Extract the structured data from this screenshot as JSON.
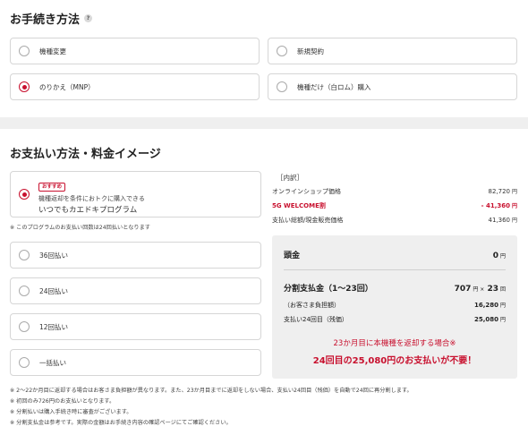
{
  "procedure": {
    "title": "お手続き方法",
    "help_icon": "?",
    "options": [
      {
        "label": "機種変更",
        "selected": false
      },
      {
        "label": "新規契約",
        "selected": false
      },
      {
        "label": "のりかえ（MNP）",
        "selected": true
      },
      {
        "label": "機種だけ（白ロム）購入",
        "selected": false
      }
    ]
  },
  "payment": {
    "title": "お支払い方法・料金イメージ",
    "recommended": {
      "badge": "おすすめ",
      "subtitle": "機種返却を条件におトクに購入できる",
      "title": "いつでもカエドキプログラム",
      "selected": true
    },
    "program_note": "※ このプログラムのお支払い回数は24回払いとなります",
    "options": [
      {
        "label": "36回払い"
      },
      {
        "label": "24回払い"
      },
      {
        "label": "12回払い"
      },
      {
        "label": "一括払い"
      }
    ]
  },
  "breakdown": {
    "heading": "［内訳］",
    "rows": [
      {
        "label": "オンラインショップ価格",
        "value": "82,720",
        "unit": "円"
      },
      {
        "label": "5G WELCOME割",
        "value": "- 41,360",
        "unit": "円"
      },
      {
        "label": "支払い総額/現金販売価格",
        "value": "41,360",
        "unit": "円"
      }
    ]
  },
  "summary": {
    "down_payment_label": "頭金",
    "down_payment_value": "0",
    "installment_label": "分割支払金（1〜23回）",
    "installment_value": "707",
    "installment_count": "23",
    "installment_unit": "円 ×",
    "count_unit": "回",
    "burden_label": "（お客さま負担額）",
    "burden_value": "16,280",
    "final_label": "支払い24回目（残価）",
    "final_value": "25,080",
    "yen": "円",
    "message1": "23か月目に本機種を返却する場合※",
    "message2": "24回目の25,080円のお支払いが不要！"
  },
  "footnotes": [
    "※ 2〜22か月目に返却する場合はお客さま負担額が異なります。また、23か月目までに返却をしない場合、支払い24回目（残価）を自動で24回に再分割します。",
    "※ 初回のみ726円のお支払いとなります。",
    "※ 分割払いは購入手続き時に審査がございます。",
    "※ 分割支払金は参考です。実際の金額はお手続き内容の確認ページにてご確認ください。"
  ],
  "colors": {
    "accent": "#c8102e",
    "panel": "#efefef",
    "divider": "#efefef"
  }
}
